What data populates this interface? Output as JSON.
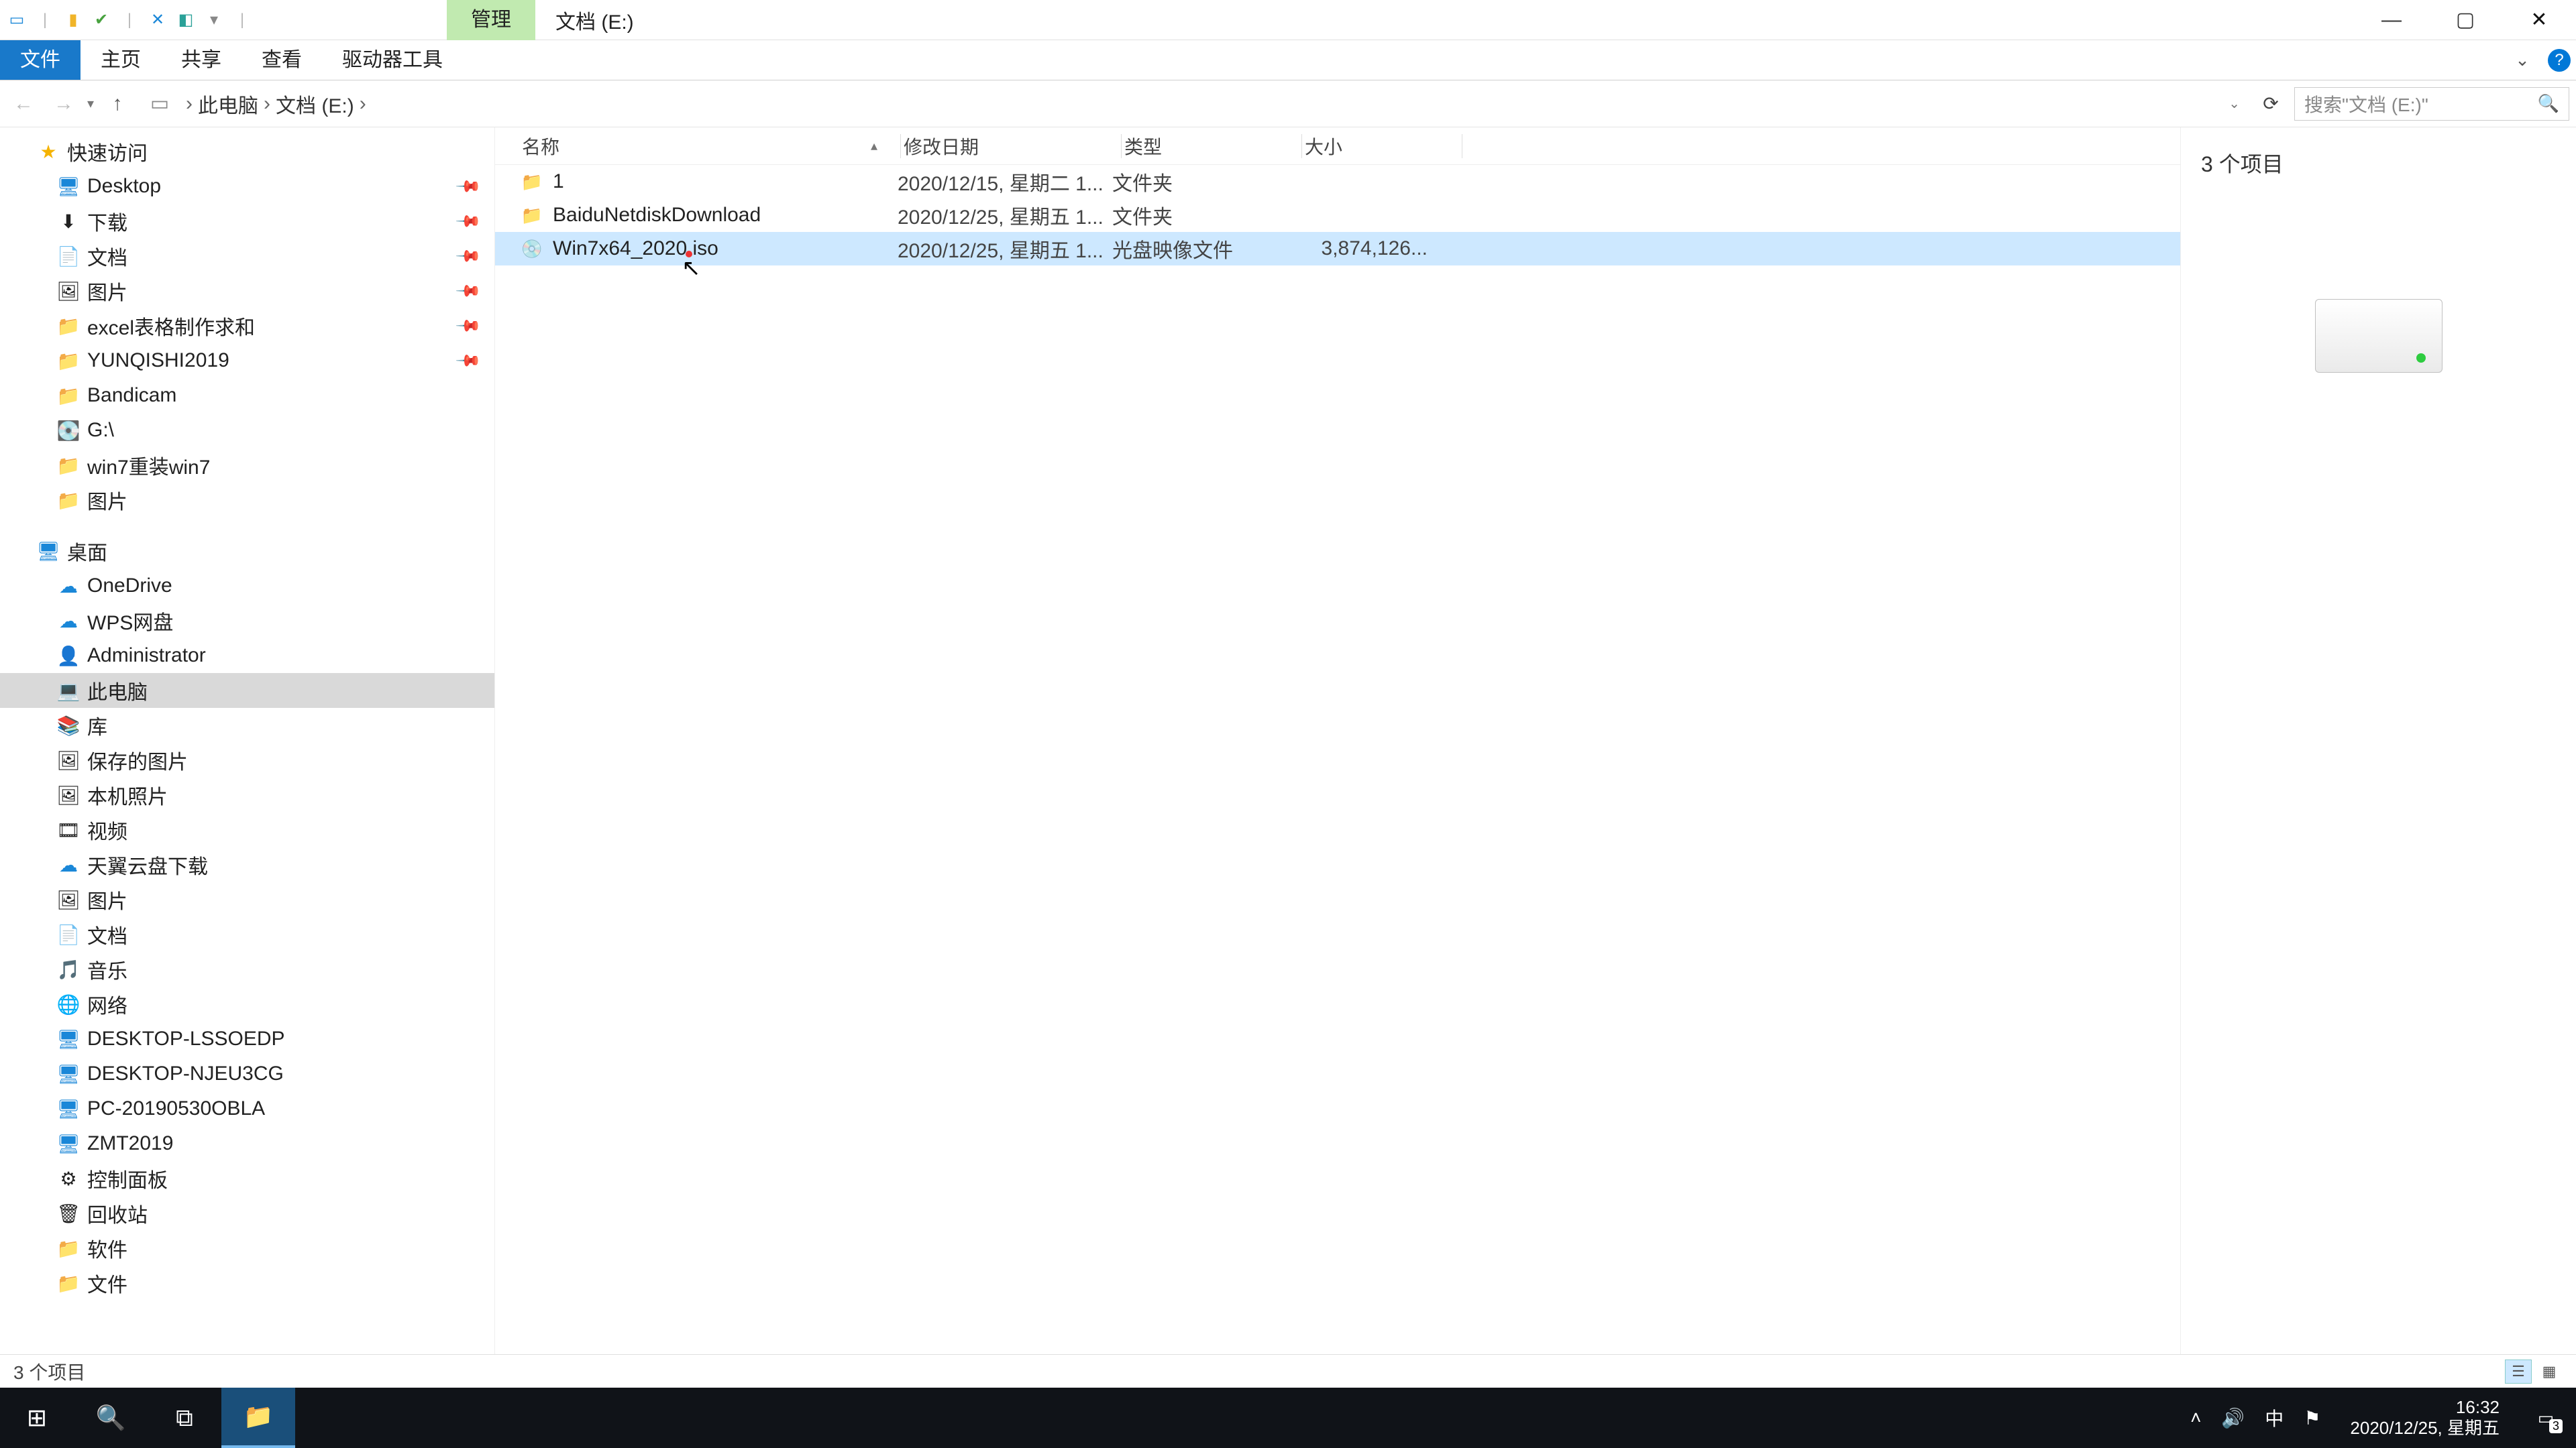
{
  "titlebar": {
    "context_tab": "管理",
    "title": "文档 (E:)"
  },
  "win_controls": {
    "min": "—",
    "max": "▢",
    "close": "✕"
  },
  "ribbon": {
    "file": "文件",
    "home": "主页",
    "share": "共享",
    "view": "查看",
    "drive_tools": "驱动器工具"
  },
  "addr": {
    "root": "此电脑",
    "drive": "文档 (E:)",
    "search_placeholder": "搜索\"文档 (E:)\""
  },
  "columns": {
    "name": "名称",
    "date": "修改日期",
    "type": "类型",
    "size": "大小"
  },
  "files": [
    {
      "name": "1",
      "date": "2020/12/15, 星期二 1...",
      "type": "文件夹",
      "size": "",
      "icon": "folder"
    },
    {
      "name": "BaiduNetdiskDownload",
      "date": "2020/12/25, 星期五 1...",
      "type": "文件夹",
      "size": "",
      "icon": "folder"
    },
    {
      "name": "Win7x64_2020.iso",
      "date": "2020/12/25, 星期五 1...",
      "type": "光盘映像文件",
      "size": "3,874,126...",
      "icon": "iso",
      "selected": true
    }
  ],
  "preview": {
    "count": "3 个项目"
  },
  "status": {
    "text": "3 个项目"
  },
  "nav": {
    "quick": {
      "label": "快速访问",
      "items": [
        {
          "label": "Desktop",
          "icon": "desktop",
          "pinned": true
        },
        {
          "label": "下载",
          "icon": "downloads",
          "pinned": true
        },
        {
          "label": "文档",
          "icon": "docs",
          "pinned": true
        },
        {
          "label": "图片",
          "icon": "pics",
          "pinned": true
        },
        {
          "label": "excel表格制作求和",
          "icon": "folder",
          "pinned": true
        },
        {
          "label": "YUNQISHI2019",
          "icon": "folder",
          "pinned": true
        },
        {
          "label": "Bandicam",
          "icon": "folder"
        },
        {
          "label": "G:\\",
          "icon": "drive"
        },
        {
          "label": "win7重装win7",
          "icon": "folder"
        },
        {
          "label": "图片",
          "icon": "folder"
        }
      ]
    },
    "desktop": {
      "label": "桌面",
      "items": [
        {
          "label": "OneDrive",
          "icon": "onedrive"
        },
        {
          "label": "WPS网盘",
          "icon": "wps"
        },
        {
          "label": "Administrator",
          "icon": "user"
        },
        {
          "label": "此电脑",
          "icon": "pc",
          "selected": true
        },
        {
          "label": "库",
          "icon": "lib"
        },
        {
          "label": "保存的图片",
          "icon": "pics",
          "indent": 1
        },
        {
          "label": "本机照片",
          "icon": "pics",
          "indent": 1
        },
        {
          "label": "视频",
          "icon": "video",
          "indent": 1
        },
        {
          "label": "天翼云盘下载",
          "icon": "cloud",
          "indent": 1
        },
        {
          "label": "图片",
          "icon": "pics",
          "indent": 1
        },
        {
          "label": "文档",
          "icon": "docs",
          "indent": 1
        },
        {
          "label": "音乐",
          "icon": "music",
          "indent": 1
        },
        {
          "label": "网络",
          "icon": "net"
        },
        {
          "label": "DESKTOP-LSSOEDP",
          "icon": "netpc",
          "indent": 1
        },
        {
          "label": "DESKTOP-NJEU3CG",
          "icon": "netpc",
          "indent": 1
        },
        {
          "label": "PC-20190530OBLA",
          "icon": "netpc",
          "indent": 1
        },
        {
          "label": "ZMT2019",
          "icon": "netpc",
          "indent": 1
        },
        {
          "label": "控制面板",
          "icon": "cpl"
        },
        {
          "label": "回收站",
          "icon": "trash"
        },
        {
          "label": "软件",
          "icon": "folder"
        },
        {
          "label": "文件",
          "icon": "folder"
        }
      ]
    }
  },
  "taskbar": {
    "time": "16:32",
    "date": "2020/12/25, 星期五",
    "ime": "中",
    "notif_count": "3"
  },
  "icons": {
    "desktop": "🖥",
    "downloads": "⬇",
    "docs": "📄",
    "pics": "🖼",
    "folder": "📁",
    "drive": "💽",
    "onedrive": "☁",
    "wps": "☁",
    "user": "👤",
    "pc": "💻",
    "lib": "📚",
    "video": "🎞",
    "cloud": "☁",
    "music": "🎵",
    "net": "🌐",
    "netpc": "🖥",
    "cpl": "⚙",
    "trash": "🗑",
    "iso": "💿"
  }
}
